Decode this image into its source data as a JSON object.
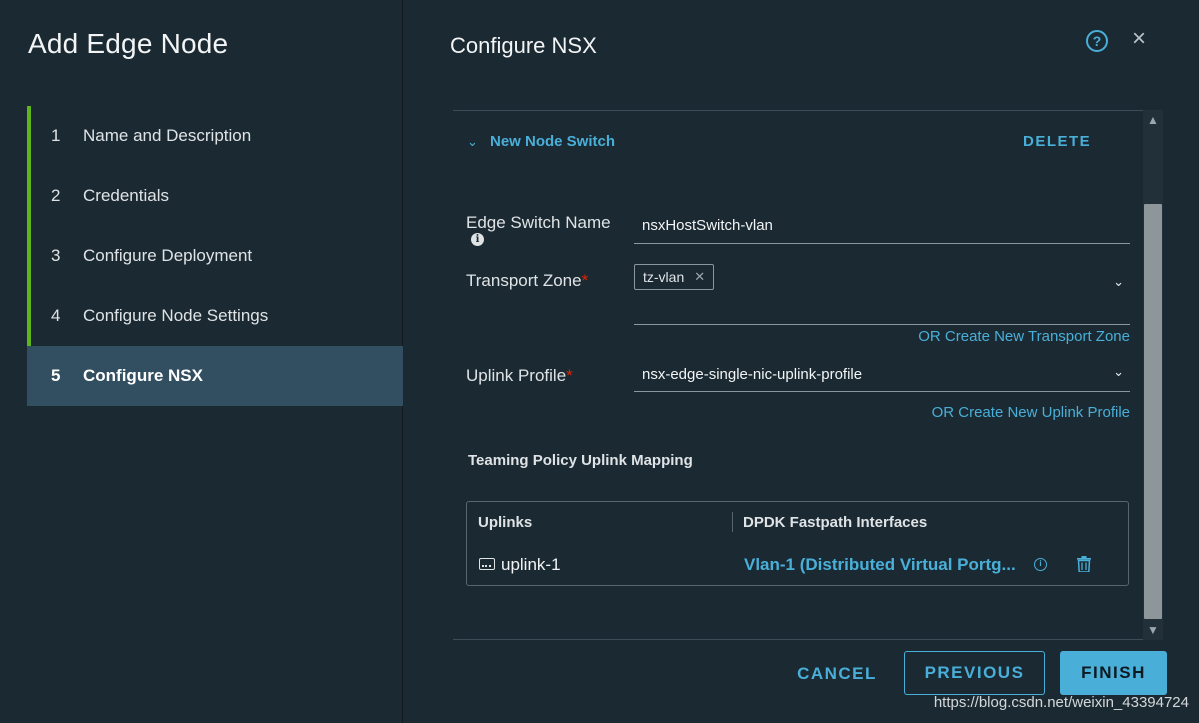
{
  "wizard": {
    "title": "Add Edge Node",
    "steps": [
      {
        "num": "1",
        "label": "Name and Description"
      },
      {
        "num": "2",
        "label": "Credentials"
      },
      {
        "num": "3",
        "label": "Configure Deployment"
      },
      {
        "num": "4",
        "label": "Configure Node Settings"
      },
      {
        "num": "5",
        "label": "Configure NSX"
      }
    ],
    "active_step": 5
  },
  "header": {
    "title": "Configure NSX",
    "help_icon": "?",
    "close_icon": "×"
  },
  "node_switch": {
    "section_title": "New Node Switch",
    "delete_label": "DELETE",
    "edge_switch_name_label": "Edge Switch Name",
    "edge_switch_name_value": "nsxHostSwitch-vlan",
    "transport_zone_label": "Transport Zone",
    "transport_zone_tag": "tz-vlan",
    "create_transport_zone_link": "OR Create New Transport Zone",
    "uplink_profile_label": "Uplink Profile",
    "uplink_profile_value": "nsx-edge-single-nic-uplink-profile",
    "create_uplink_profile_link": "OR Create New Uplink Profile",
    "required_mark": "*"
  },
  "teaming": {
    "heading": "Teaming Policy Uplink Mapping",
    "columns": [
      "Uplinks",
      "DPDK Fastpath Interfaces"
    ],
    "rows": [
      {
        "uplink": "uplink-1",
        "interface": "Vlan-1 (Distributed Virtual Portg..."
      }
    ]
  },
  "footer": {
    "cancel": "CANCEL",
    "previous": "PREVIOUS",
    "finish": "FINISH"
  },
  "watermark": "https://blog.csdn.net/weixin_43394724",
  "colors": {
    "accent": "#49afd9",
    "step_bar": "#5fb61a",
    "active_step_bg": "#324f61",
    "background": "#1b2a32",
    "required": "#e12200"
  }
}
